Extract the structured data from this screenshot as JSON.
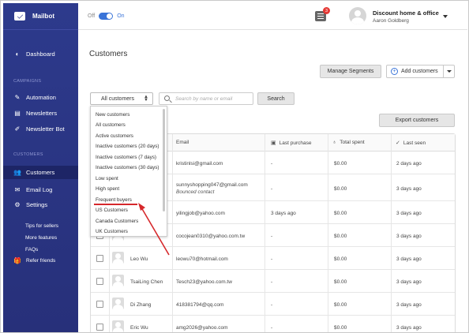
{
  "app": {
    "name": "Mailbot"
  },
  "colors": {
    "sidebar": "#2d3a8c",
    "accent": "#3a74d8",
    "annotation": "#d6282b",
    "badge": "#e53935"
  },
  "sidebar": {
    "dashboard": "Dashboard",
    "campaigns_label": "CAMPAIGNS",
    "automation": "Automation",
    "newsletters": "Newsletters",
    "newsletter_bot": "Newsletter Bot",
    "customers_label": "CUSTOMERS",
    "customers": "Customers",
    "email_log": "Email Log",
    "settings": "Settings",
    "tips": "Tips for sellers",
    "more_features": "More features",
    "faqs": "FAQs",
    "refer": "Refer friends",
    "icons": {
      "dashboard": "dashboard-icon",
      "automation": "wand-icon",
      "newsletters": "envelope-stack-icon",
      "newsletter_bot": "edit-icon",
      "customers": "users-icon",
      "email_log": "envelope-icon",
      "settings": "gear-icon",
      "refer": "gift-icon"
    }
  },
  "topbar": {
    "off": "Off",
    "on": "On",
    "notification_count": "3",
    "company": "Discount home & office",
    "user": "Aaron Goldberg"
  },
  "main": {
    "title": "Customers",
    "manage_segments": "Manage Segments",
    "add_customers": "Add customers",
    "filter_value": "All customers",
    "search_placeholder": "Search by name or email",
    "search_button": "Search",
    "export_button": "Export customers"
  },
  "dropdown": {
    "options": [
      "New customers",
      "All customers",
      "Active customers",
      "Inactive customers (20 days)",
      "Inactive customers (7 days)",
      "Inactive customers (30 days)",
      "Low spent",
      "High spent",
      "Frequent buyers",
      "US Customers",
      "Canada Customers",
      "UK Customers"
    ],
    "highlighted": "Frequent buyers"
  },
  "table": {
    "headers": {
      "email": "Email",
      "last_purchase": "Last purchase",
      "total_spent": "Total spent",
      "last_seen": "Last seen"
    },
    "rows": [
      {
        "name": "",
        "email": "kristinlsi@gmail.com",
        "note": "",
        "last_purchase": "-",
        "total_spent": "$0.00",
        "last_seen": "2 days ago"
      },
      {
        "name": "",
        "email": "sunnyshopping047@gmail.com",
        "note": "Bounced contact",
        "last_purchase": "-",
        "total_spent": "$0.00",
        "last_seen": "3 days ago"
      },
      {
        "name": "",
        "email": "yilingjob@yahoo.com",
        "note": "",
        "last_purchase": "3 days ago",
        "total_spent": "$0.00",
        "last_seen": "3 days ago"
      },
      {
        "name": "",
        "email": "cocojean0310@yahoo.com.tw",
        "note": "",
        "last_purchase": "-",
        "total_spent": "$0.00",
        "last_seen": "3 days ago"
      },
      {
        "name": "Leo Wu",
        "email": "leowu70@hotmail.com",
        "note": "",
        "last_purchase": "-",
        "total_spent": "$0.00",
        "last_seen": "3 days ago"
      },
      {
        "name": "TsaiLing Chen",
        "email": "Tesch23@yahoo.com.tw",
        "note": "",
        "last_purchase": "-",
        "total_spent": "$0.00",
        "last_seen": "3 days ago"
      },
      {
        "name": "Di Zhang",
        "email": "418381794@qq.com",
        "note": "",
        "last_purchase": "-",
        "total_spent": "$0.00",
        "last_seen": "3 days ago"
      },
      {
        "name": "Eric Wu",
        "email": "amg2026@yahoo.com",
        "note": "",
        "last_purchase": "-",
        "total_spent": "$0.00",
        "last_seen": "3 days ago"
      }
    ]
  }
}
